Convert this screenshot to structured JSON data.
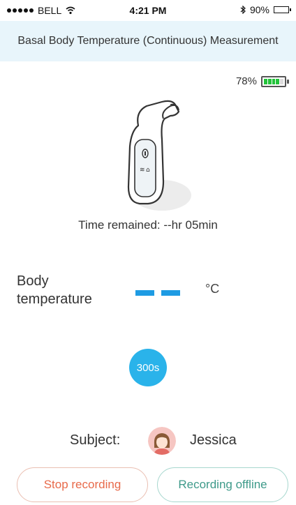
{
  "status_bar": {
    "carrier": "BELL",
    "time": "4:21 PM",
    "battery": "90%",
    "icons": [
      "signal-dots-icon",
      "wifi-icon",
      "bluetooth-icon",
      "battery-icon"
    ]
  },
  "header": {
    "title": "Basal Body Temperature (Continuous) Measurement"
  },
  "device": {
    "battery_percent": "78%",
    "battery_level": 0.78,
    "image": "ear-thermometer-illustration"
  },
  "measurement": {
    "time_remaining": "Time remained: --hr 05min",
    "label_line1": "Body",
    "label_line2": "temperature",
    "unit": "°C"
  },
  "timer": {
    "label": "300s"
  },
  "subject": {
    "label": "Subject:",
    "name": "Jessica",
    "avatar": "female-avatar"
  },
  "actions": {
    "stop": "Stop recording",
    "offline": "Recording offline"
  },
  "colors": {
    "accent": "#2ab3ea",
    "header_bg": "#e8f5fb",
    "stop": "#e86a4a",
    "offline": "#3e9a8a",
    "battery_green": "#23c23a"
  }
}
